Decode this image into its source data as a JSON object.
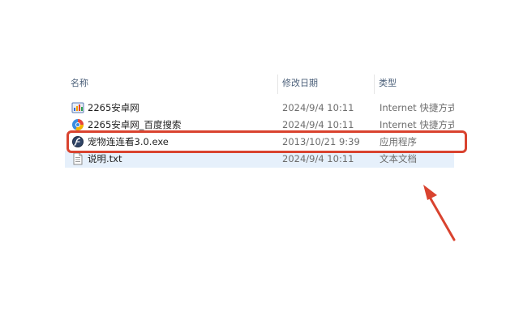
{
  "columns": {
    "name": "名称",
    "date": "修改日期",
    "type": "类型"
  },
  "files": [
    {
      "name": "2265安卓网",
      "date": "2024/9/4 10:11",
      "type": "Internet 快捷方式",
      "icon": "url-shortcut-icon"
    },
    {
      "name": "2265安卓网_百度搜索",
      "date": "2024/9/4 10:11",
      "type": "Internet 快捷方式",
      "icon": "browser-shortcut-icon"
    },
    {
      "name": "宠物连连看3.0.exe",
      "date": "2013/10/21 9:39",
      "type": "应用程序",
      "icon": "application-icon"
    },
    {
      "name": "说明.txt",
      "date": "2024/9/4 10:11",
      "type": "文本文档",
      "icon": "text-file-icon"
    }
  ],
  "colors": {
    "highlight": "#d9432f",
    "selected_row": "#e6f0fb",
    "header_text": "#4c607a"
  }
}
